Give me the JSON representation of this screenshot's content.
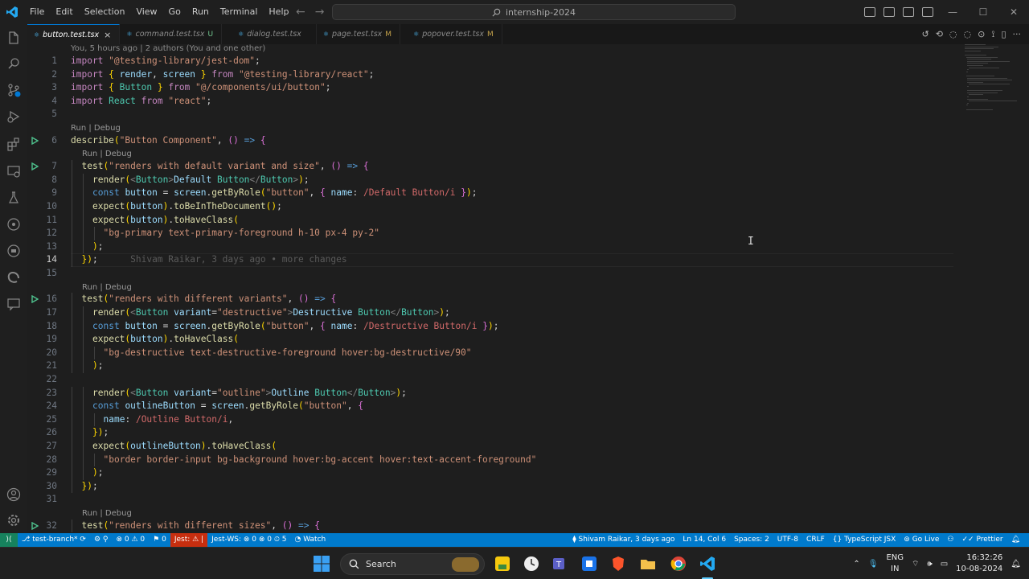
{
  "menu": [
    "File",
    "Edit",
    "Selection",
    "View",
    "Go",
    "Run",
    "Terminal",
    "Help"
  ],
  "search_title": "internship-2024",
  "tabs": [
    {
      "label": "button.test.tsx",
      "badge": "",
      "active": true
    },
    {
      "label": "command.test.tsx",
      "badge": "U",
      "active": false
    },
    {
      "label": "dialog.test.tsx",
      "badge": "",
      "active": false
    },
    {
      "label": "page.test.tsx",
      "badge": "M",
      "active": false
    },
    {
      "label": "popover.test.tsx",
      "badge": "M",
      "active": false
    }
  ],
  "editor": {
    "blame_header": "You, 5 hours ago | 2 authors (You and one other)",
    "codelens": "Run | Debug",
    "inline_blame": "Shivam Raikar, 3 days ago • more changes",
    "current_line": 14,
    "lines": [
      {
        "n": 1,
        "text": "import \"@testing-library/jest-dom\";"
      },
      {
        "n": 2,
        "text": "import { render, screen } from \"@testing-library/react\";"
      },
      {
        "n": 3,
        "text": "import { Button } from \"@/components/ui/button\";"
      },
      {
        "n": 4,
        "text": "import React from \"react\";"
      },
      {
        "n": 5,
        "text": ""
      },
      {
        "n": 6,
        "text": "describe(\"Button Component\", () => {"
      },
      {
        "n": 7,
        "text": "  test(\"renders with default variant and size\", () => {"
      },
      {
        "n": 8,
        "text": "    render(<Button>Default Button</Button>);"
      },
      {
        "n": 9,
        "text": "    const button = screen.getByRole(\"button\", { name: /Default Button/i });"
      },
      {
        "n": 10,
        "text": "    expect(button).toBeInTheDocument();"
      },
      {
        "n": 11,
        "text": "    expect(button).toHaveClass("
      },
      {
        "n": 12,
        "text": "      \"bg-primary text-primary-foreground h-10 px-4 py-2\""
      },
      {
        "n": 13,
        "text": "    );"
      },
      {
        "n": 14,
        "text": "  });"
      },
      {
        "n": 15,
        "text": ""
      },
      {
        "n": 16,
        "text": "  test(\"renders with different variants\", () => {"
      },
      {
        "n": 17,
        "text": "    render(<Button variant=\"destructive\">Destructive Button</Button>);"
      },
      {
        "n": 18,
        "text": "    const button = screen.getByRole(\"button\", { name: /Destructive Button/i });"
      },
      {
        "n": 19,
        "text": "    expect(button).toHaveClass("
      },
      {
        "n": 20,
        "text": "      \"bg-destructive text-destructive-foreground hover:bg-destructive/90\""
      },
      {
        "n": 21,
        "text": "    );"
      },
      {
        "n": 22,
        "text": ""
      },
      {
        "n": 23,
        "text": "    render(<Button variant=\"outline\">Outline Button</Button>);"
      },
      {
        "n": 24,
        "text": "    const outlineButton = screen.getByRole(\"button\", {"
      },
      {
        "n": 25,
        "text": "      name: /Outline Button/i,"
      },
      {
        "n": 26,
        "text": "    });"
      },
      {
        "n": 27,
        "text": "    expect(outlineButton).toHaveClass("
      },
      {
        "n": 28,
        "text": "      \"border border-input bg-background hover:bg-accent hover:text-accent-foreground\""
      },
      {
        "n": 29,
        "text": "    );"
      },
      {
        "n": 30,
        "text": "  });"
      },
      {
        "n": 31,
        "text": ""
      },
      {
        "n": 32,
        "text": "  test(\"renders with different sizes\", () => {"
      }
    ]
  },
  "statusbar": {
    "branch": "test-branch*",
    "problems": "0 ⚠ 0",
    "ports": "0",
    "jest": "Jest: ⚠ |",
    "jest_ws": "Jest-WS: ⊗ 0 ⊗ 0 ⏲ 5",
    "watch": "Watch",
    "blame": "Shivam Raikar, 3 days ago",
    "position": "Ln 14, Col 6",
    "spaces": "Spaces: 2",
    "encoding": "UTF-8",
    "eol": "CRLF",
    "language": "TypeScript JSX",
    "golive": "Go Live",
    "prettier": "Prettier"
  },
  "taskbar": {
    "search": "Search",
    "lang_top": "ENG",
    "lang_bottom": "IN",
    "time": "16:32:26",
    "date": "10-08-2024"
  },
  "colors": {
    "accent": "#007acc",
    "background": "#1e1e1e"
  }
}
